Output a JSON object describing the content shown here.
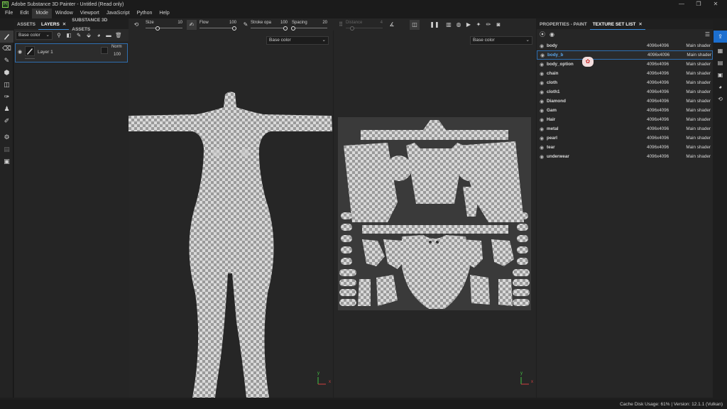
{
  "window": {
    "title": "Adobe Substance 3D Painter - Untitled (Read only)",
    "logo_text": "Pt",
    "controls": [
      "—",
      "❐",
      "✕"
    ]
  },
  "menu": [
    "File",
    "Edit",
    "Mode",
    "Window",
    "Viewport",
    "JavaScript",
    "Python",
    "Help"
  ],
  "active_menu": "Mode",
  "left_panel": {
    "tabs": [
      {
        "label": "ASSETS"
      },
      {
        "label": "LAYERS",
        "close": "✕"
      },
      {
        "label": "SUBSTANCE 3D ASSETS"
      }
    ],
    "channel": "Base color",
    "layer": {
      "name": "Layer 1",
      "blend": "Norm",
      "opacity": "100"
    }
  },
  "toolbar": {
    "size": {
      "label": "Size",
      "value": "10"
    },
    "flow": {
      "label": "Flow",
      "value": "100"
    },
    "stroke_opacity": {
      "label": "Stroke opa",
      "value": "100"
    },
    "spacing": {
      "label": "Spacing",
      "value": "20"
    },
    "distance": {
      "label": "Distance",
      "value": "4"
    }
  },
  "viewport3d": {
    "channel": "Base color",
    "axis_y": "y",
    "axis_x": "x"
  },
  "viewport2d": {
    "channel": "Base color",
    "axis_y": "y",
    "axis_x": "x"
  },
  "right_panel": {
    "tabs": [
      {
        "label": "PROPERTIES - PAINT"
      },
      {
        "label": "TEXTURE SET LIST",
        "close": "✕"
      }
    ],
    "texture_sets": [
      {
        "name": "body",
        "resolution": "4096x4096",
        "shader": "Main shader"
      },
      {
        "name": "body_b",
        "resolution": "4096x4096",
        "shader": "Main shader",
        "selected": true
      },
      {
        "name": "body_option",
        "resolution": "4096x4096",
        "shader": "Main shader"
      },
      {
        "name": "chain",
        "resolution": "4096x4096",
        "shader": "Main shader"
      },
      {
        "name": "cloth",
        "resolution": "4096x4096",
        "shader": "Main shader"
      },
      {
        "name": "cloth1",
        "resolution": "4096x4096",
        "shader": "Main shader"
      },
      {
        "name": "Diamond",
        "resolution": "4096x4096",
        "shader": "Main shader"
      },
      {
        "name": "Gam",
        "resolution": "4096x4096",
        "shader": "Main shader"
      },
      {
        "name": "Hair",
        "resolution": "4096x4096",
        "shader": "Main shader"
      },
      {
        "name": "metal",
        "resolution": "4096x4096",
        "shader": "Main shader"
      },
      {
        "name": "pearl",
        "resolution": "4096x4096",
        "shader": "Main shader"
      },
      {
        "name": "tear",
        "resolution": "4096x4096",
        "shader": "Main shader"
      },
      {
        "name": "underwear",
        "resolution": "4096x4096",
        "shader": "Main shader"
      }
    ]
  },
  "status": "Cache Disk Usage:    61% | Version: 12.1.1 (Vulkan)",
  "colors": {
    "accent": "#3b8fe0",
    "selection_border": "#2f6fb0",
    "checker_light": "#d9d9d9",
    "checker_dark": "#9a9a9a"
  }
}
